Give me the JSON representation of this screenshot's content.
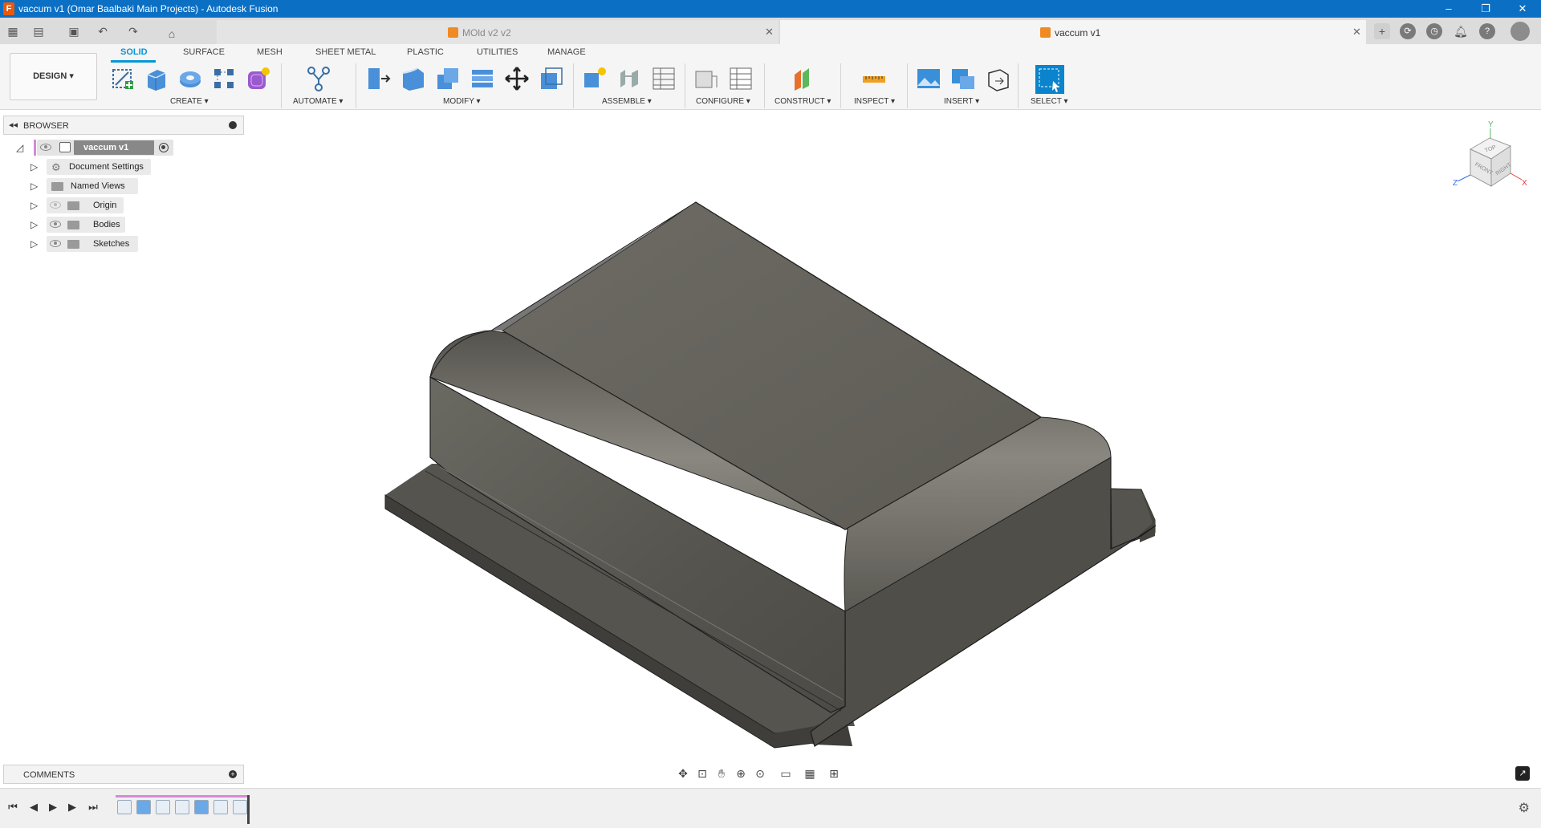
{
  "window": {
    "title": "vaccum v1 (Omar Baalbaki Main Projects) - Autodesk Fusion",
    "app_icon": "F",
    "controls": [
      "–",
      "❐",
      "✕"
    ]
  },
  "tabs": [
    {
      "label": "MOld v2 v2",
      "active": false
    },
    {
      "label": "vaccum v1",
      "active": true
    }
  ],
  "toolbar": {
    "workspace": "DESIGN",
    "mode_tabs": [
      "SOLID",
      "SURFACE",
      "MESH",
      "SHEET METAL",
      "PLASTIC",
      "UTILITIES",
      "MANAGE"
    ],
    "active_mode": "SOLID",
    "groups": [
      "CREATE",
      "AUTOMATE",
      "MODIFY",
      "ASSEMBLE",
      "CONFIGURE",
      "CONSTRUCT",
      "INSPECT",
      "INSERT",
      "SELECT"
    ]
  },
  "browser": {
    "title": "BROWSER",
    "root": "vaccum v1",
    "items": [
      "Document Settings",
      "Named Views",
      "Origin",
      "Bodies",
      "Sketches"
    ]
  },
  "comments": {
    "title": "COMMENTS"
  },
  "viewcube": {
    "faces": [
      "TOP",
      "FRONT",
      "RIGHT"
    ],
    "axes": [
      "Y",
      "Z",
      "X"
    ]
  },
  "colors": {
    "titlebar": "#0b6fc4",
    "accent": "#0696d7",
    "model": "#5a5852"
  }
}
